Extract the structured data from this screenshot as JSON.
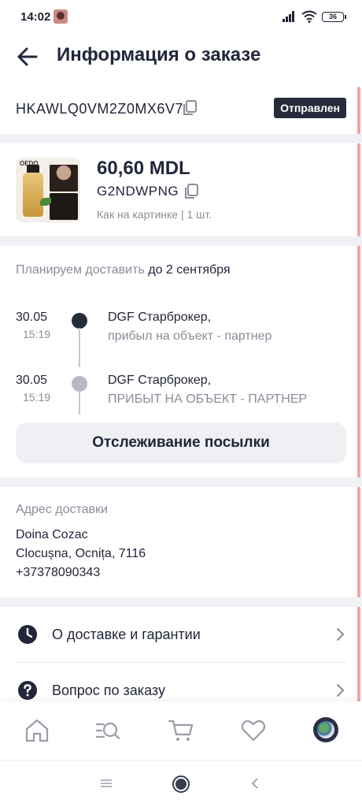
{
  "status_bar": {
    "time": "14:02",
    "battery": "36"
  },
  "header": {
    "title": "Информация о заказе",
    "back_icon": "arrow-left-icon"
  },
  "order": {
    "id": "HKAWLQ0VM2Z0MX6V7",
    "status": "Отправлен",
    "copy_icon": "copy-icon"
  },
  "product": {
    "price": "60,60 MDL",
    "sku": "G2NDWPNG",
    "variant": "Как на картинке | 1 шт.",
    "brand": "OEDO"
  },
  "delivery": {
    "plan_label": "Планируем доставить",
    "plan_date": "до 2 сентября",
    "events": [
      {
        "date": "30.05",
        "time": "15:19",
        "place": "DGF Старброкер,",
        "event": "прибыл на объект - партнер",
        "active": true
      },
      {
        "date": "30.05",
        "time": "15:19",
        "place": "DGF Старброкер,",
        "event": "ПРИБЫТ НА ОБЪЕКТ - ПАРТНЕР",
        "active": false
      }
    ],
    "track_button": "Отслеживание посылки"
  },
  "address": {
    "label": "Адрес доставки",
    "name": "Doina Cozac",
    "city": "Clocușna, Ocnița, 7116",
    "phone": "+37378090343"
  },
  "menu": [
    {
      "label": "О доставке и гарантии",
      "icon": "clock-icon"
    },
    {
      "label": "Вопрос по заказу",
      "icon": "question-icon"
    }
  ],
  "tabbar": [
    "home-icon",
    "catalog-search-icon",
    "cart-icon",
    "heart-icon",
    "profile-avatar"
  ],
  "colors": {
    "primary": "#22263a",
    "muted": "#8a8d99",
    "badge_bg": "#262b3c",
    "divider": "#f0f1f5",
    "active_dot": "#262b3c",
    "inactive_dot": "#b6b8c4"
  }
}
